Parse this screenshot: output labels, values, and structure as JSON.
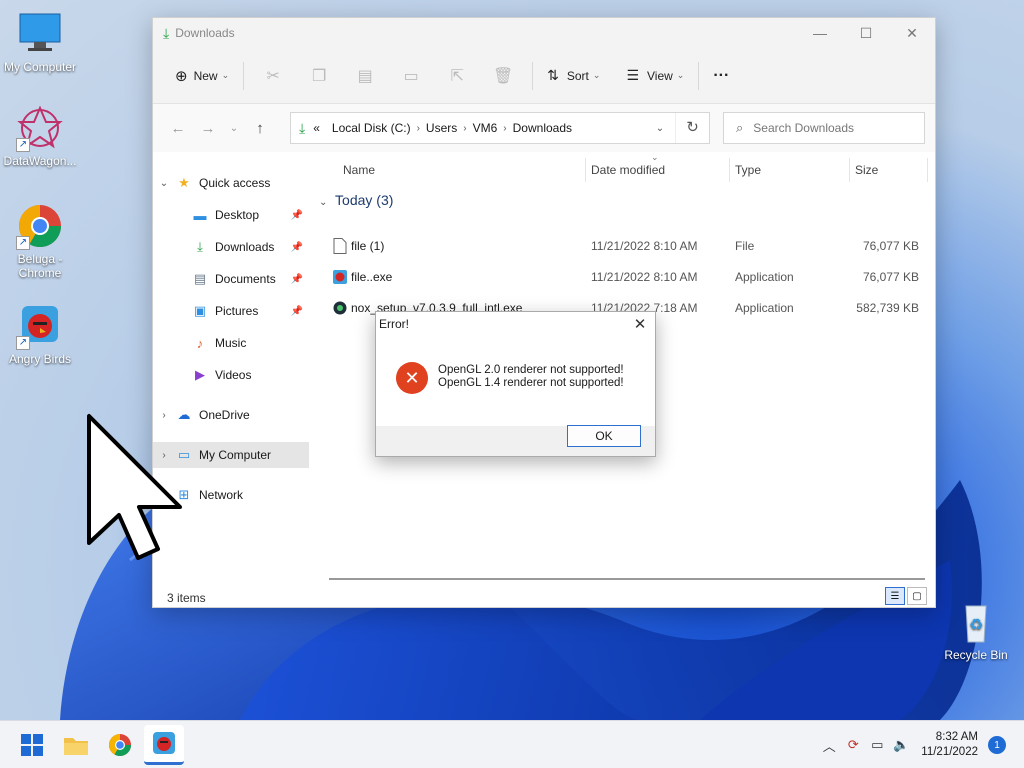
{
  "desktop": {
    "icons": [
      {
        "label": "My Computer"
      },
      {
        "label": "DataWagon..."
      },
      {
        "label": "Beluga - Chrome"
      },
      {
        "label": "Angry Birds"
      },
      {
        "label": "Recycle Bin"
      }
    ]
  },
  "explorer": {
    "title": "Downloads",
    "toolbar": {
      "new_label": "New",
      "sort_label": "Sort",
      "view_label": "View",
      "more_label": "···"
    },
    "address": {
      "prefix": "«",
      "crumbs": [
        "Local Disk (C:)",
        "Users",
        "VM6",
        "Downloads"
      ]
    },
    "search_placeholder": "Search Downloads",
    "nav": {
      "quick_access": "Quick access",
      "items": [
        "Desktop",
        "Downloads",
        "Documents",
        "Pictures",
        "Music",
        "Videos"
      ],
      "onedrive": "OneDrive",
      "my_computer": "My Computer",
      "network": "Network"
    },
    "columns": {
      "name": "Name",
      "date": "Date modified",
      "type": "Type",
      "size": "Size"
    },
    "group_label": "Today (3)",
    "files": [
      {
        "name": "file (1)",
        "date": "11/21/2022 8:10 AM",
        "type": "File",
        "size": "76,077 KB"
      },
      {
        "name": "file..exe",
        "date": "11/21/2022 8:10 AM",
        "type": "Application",
        "size": "76,077 KB"
      },
      {
        "name": "nox_setup_v7.0.3.9_full_intl.exe",
        "date": "11/21/2022 7:18 AM",
        "type": "Application",
        "size": "582,739 KB"
      }
    ],
    "status": "3 items"
  },
  "dialog": {
    "title": "Error!",
    "line1": "OpenGL 2.0 renderer not supported!",
    "line2": "OpenGL 1.4 renderer not supported!",
    "ok_label": "OK"
  },
  "taskbar": {
    "time": "8:32 AM",
    "date": "11/21/2022",
    "notification_count": "1"
  }
}
